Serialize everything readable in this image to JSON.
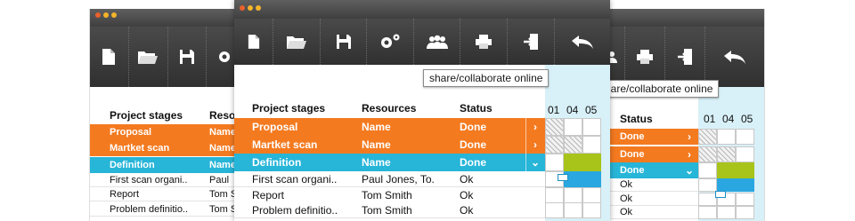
{
  "toolbar_tooltip": "share/collaborate online",
  "icons": [
    "new-document-icon",
    "open-folder-icon",
    "save-icon",
    "settings-icon",
    "share-users-icon",
    "print-icon",
    "export-icon",
    "undo-icon"
  ],
  "colors": {
    "orange": "#f47a20",
    "cyan": "#27b5d8",
    "lime": "#a8c41a",
    "dark": "#3a3a3a"
  },
  "table": {
    "headers": {
      "stages": "Project stages",
      "resources": "Resources",
      "status": "Status"
    },
    "rows": [
      {
        "stage": "Proposal",
        "resource": "Name",
        "status": "Done",
        "style": "orange"
      },
      {
        "stage": "Martket scan",
        "resource": "Name",
        "status": "Done",
        "style": "orange"
      },
      {
        "stage": "Definition",
        "resource": "Name",
        "status": "Done",
        "style": "cyan"
      },
      {
        "stage": "First scan organi..",
        "resource": "Paul Jones, To.",
        "status": "Ok",
        "style": "white"
      },
      {
        "stage": "Report",
        "resource": "Tom Smith",
        "status": "Ok",
        "style": "white"
      },
      {
        "stage": "Problem definitio..",
        "resource": "Tom Smith",
        "status": "Ok",
        "style": "white"
      }
    ],
    "left_resource_header": "Reso",
    "left_resources": [
      "Name",
      "Name",
      "Name",
      "Paul",
      "Tom S",
      "Tom S"
    ],
    "right_status": [
      "Done",
      "Done",
      "Done",
      "Ok",
      "Ok",
      "Ok"
    ]
  },
  "gantt": {
    "days": [
      "01",
      "04",
      "05"
    ]
  }
}
